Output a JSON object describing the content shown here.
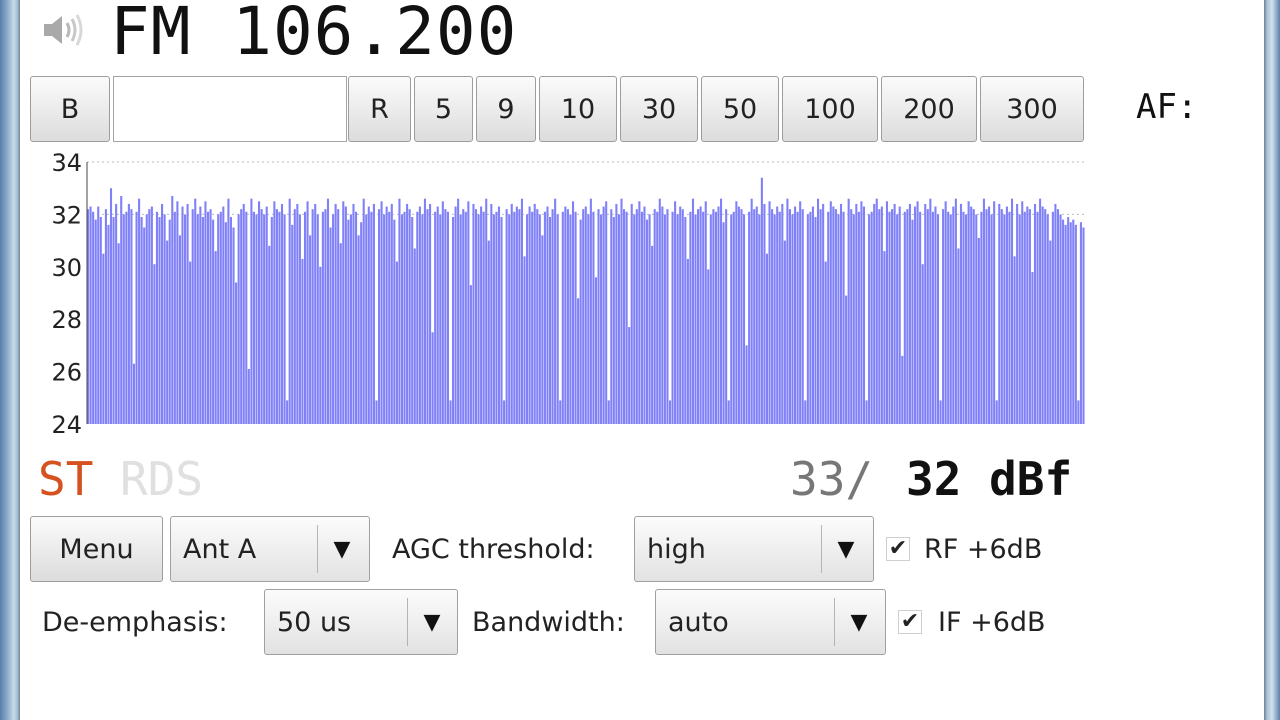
{
  "header": {
    "frequency": "FM 106.200",
    "af_label": "AF:",
    "speaker_icon": "speaker-icon"
  },
  "band_buttons": {
    "b": "B",
    "input_value": "",
    "r": "R",
    "steps": [
      "5",
      "9",
      "10",
      "30",
      "50",
      "100",
      "200",
      "300"
    ]
  },
  "indicators": {
    "stereo": "ST",
    "rds": "RDS",
    "stereo_color": "#d5511f",
    "rds_color": "#e0e0e0"
  },
  "signal": {
    "peak": "33/",
    "current": "32 dBf"
  },
  "controls": {
    "menu_label": "Menu",
    "antenna_value": "Ant A",
    "agc_label": "AGC threshold:",
    "agc_value": "high",
    "rf_label": "RF +6dB",
    "rf_checked": true,
    "deemphasis_label": "De-emphasis:",
    "deemphasis_value": "50 us",
    "bandwidth_label": "Bandwidth:",
    "bandwidth_value": "auto",
    "if_label": "IF +6dB",
    "if_checked": true,
    "check_mark": "✔",
    "dropdown_icon": "dropdown-arrow-icon"
  },
  "chart_data": {
    "type": "bar",
    "ylim": [
      24,
      34
    ],
    "yticks": [
      "34",
      "32",
      "30",
      "28",
      "26",
      "24"
    ],
    "bar_color": "#8080f8",
    "grid_color": "#bbbbbb",
    "series": [
      {
        "values": [
          32.2,
          32.3,
          32.1,
          31.8,
          32.3,
          31.9,
          32.0,
          32.2,
          31.6,
          33.0,
          31.9,
          32.4,
          32.1,
          32.7,
          32.0,
          32.1,
          32.4,
          32.2,
          30.0,
          32.1,
          32.6,
          31.9,
          31.5,
          32.0,
          32.2,
          32.3,
          32.5,
          32.1,
          31.9,
          32.4,
          32.0,
          32.2,
          31.8,
          32.7,
          32.1,
          32.5,
          31.2,
          32.3,
          32.0,
          32.4,
          32.1,
          32.2,
          32.6,
          32.0,
          32.3,
          31.9,
          32.5,
          32.1,
          32.2,
          31.8,
          32.4,
          32.0,
          32.1,
          32.3,
          31.7,
          32.6,
          31.9,
          31.5,
          32.3,
          32.0,
          32.2,
          32.4,
          32.1,
          26.1,
          32.6,
          32.1,
          32.0,
          32.5,
          32.2,
          32.0,
          32.3,
          32.1,
          31.9,
          32.5,
          32.2,
          32.1,
          32.4,
          32.0,
          32.3,
          32.6,
          31.6,
          32.2,
          32.4,
          32.0,
          32.3,
          32.1,
          32.5,
          31.2,
          32.2,
          32.4,
          32.0,
          32.3,
          32.1,
          32.2,
          32.6,
          31.5,
          32.0,
          32.4,
          32.2,
          32.1,
          32.5,
          32.3,
          31.8,
          32.0,
          32.4,
          32.1,
          32.2,
          31.7,
          32.6,
          32.0,
          32.3,
          32.1,
          32.4,
          31.9,
          32.2,
          32.5,
          32.0,
          32.3,
          32.1,
          32.4,
          31.8,
          32.2,
          32.6,
          32.0,
          32.1,
          32.4,
          32.2,
          31.9,
          32.5,
          32.1,
          32.3,
          32.0,
          32.6,
          32.2,
          32.4,
          31.5,
          32.1,
          32.3,
          32.0,
          32.5,
          32.2,
          32.1,
          32.4,
          31.9,
          32.3,
          32.6,
          32.0,
          32.2,
          32.1,
          32.5,
          31.8,
          32.4,
          32.2,
          32.0,
          32.3,
          32.1,
          32.6,
          32.2,
          32.4,
          32.0,
          32.1,
          32.3,
          31.9,
          32.5,
          32.2,
          32.0,
          32.4,
          32.1,
          32.3,
          32.2,
          32.6,
          31.7,
          32.0,
          32.3,
          32.1,
          32.4,
          32.2,
          32.0,
          32.5,
          32.1,
          32.3,
          31.9,
          32.2,
          32.6,
          32.0,
          32.4,
          32.1,
          32.3,
          32.2,
          32.0,
          32.5,
          32.1,
          32.4,
          31.8,
          32.2,
          32.3,
          32.0,
          32.6,
          32.1,
          32.4,
          32.2,
          32.0,
          32.3,
          32.5,
          32.1,
          32.2,
          31.9,
          32.4,
          32.0,
          32.6,
          32.2,
          32.1,
          32.3,
          32.4,
          32.0,
          32.2,
          32.5,
          32.1,
          32.3,
          31.8,
          32.0,
          32.4,
          32.2,
          32.1,
          32.6,
          32.3,
          32.0,
          32.2,
          32.4,
          32.1,
          32.5,
          32.0,
          32.3,
          32.2,
          31.9,
          32.4,
          32.1,
          32.6,
          32.0,
          32.2,
          32.3,
          32.1,
          32.5,
          32.4,
          32.0,
          32.2,
          32.1,
          32.3,
          32.6,
          31.7,
          32.2,
          32.4,
          32.0,
          32.1,
          32.5,
          32.3,
          32.2,
          32.0,
          32.4,
          32.1,
          32.6,
          32.2,
          32.3,
          32.0,
          33.4,
          32.4,
          32.1,
          32.5,
          32.2,
          32.0,
          32.3,
          32.1,
          32.4,
          31.8,
          32.6,
          32.2,
          32.0,
          32.3,
          32.1,
          32.5,
          32.2,
          32.4,
          32.0,
          32.1,
          32.3,
          31.9,
          32.6,
          32.2,
          32.4,
          32.0,
          32.1,
          32.5,
          32.3,
          32.2,
          32.0,
          32.4,
          32.1,
          32.3,
          32.6,
          32.2,
          32.0,
          32.4,
          32.1,
          32.5,
          32.3,
          32.2,
          32.0,
          32.1,
          32.4,
          32.6,
          32.2,
          32.3,
          32.0,
          32.5,
          32.1,
          32.2,
          32.4,
          32.0,
          32.3,
          32.6,
          32.1,
          32.2,
          32.4,
          31.8,
          32.3,
          32.5,
          32.1,
          32.0,
          32.4,
          32.2,
          32.6,
          32.1,
          32.3,
          32.0,
          32.4,
          32.2,
          32.5,
          32.1,
          32.0,
          32.3,
          32.6,
          32.2,
          32.4,
          32.1,
          32.0,
          32.5,
          32.3,
          32.2,
          32.0,
          32.4,
          32.1,
          32.6,
          32.2,
          32.3,
          32.0,
          32.5,
          32.1,
          32.4,
          32.2,
          32.0,
          32.3,
          32.1,
          32.6,
          32.2,
          32.4,
          32.0,
          32.5,
          32.1,
          32.3,
          32.2,
          32.0,
          32.4,
          32.1,
          32.6,
          32.3,
          32.2,
          32.0,
          32.5,
          32.1,
          32.4,
          32.2,
          32.0,
          31.8,
          31.6,
          31.9,
          31.7,
          31.8,
          31.6,
          24.9,
          31.7,
          31.5
        ]
      }
    ],
    "dips": [
      {
        "at": 6,
        "value": 30.5
      },
      {
        "at": 12,
        "value": 30.9
      },
      {
        "at": 18,
        "value": 26.3
      },
      {
        "at": 26,
        "value": 30.1
      },
      {
        "at": 31,
        "value": 31.0
      },
      {
        "at": 40,
        "value": 30.2
      },
      {
        "at": 50,
        "value": 30.6
      },
      {
        "at": 58,
        "value": 29.4
      },
      {
        "at": 63,
        "value": 26.1
      },
      {
        "at": 71,
        "value": 30.8
      },
      {
        "at": 78,
        "value": 24.9
      },
      {
        "at": 84,
        "value": 30.3
      },
      {
        "at": 91,
        "value": 30.0
      },
      {
        "at": 99,
        "value": 30.9
      },
      {
        "at": 106,
        "value": 31.2
      },
      {
        "at": 113,
        "value": 24.9
      },
      {
        "at": 121,
        "value": 30.2
      },
      {
        "at": 128,
        "value": 30.7
      },
      {
        "at": 135,
        "value": 27.5
      },
      {
        "at": 142,
        "value": 24.9
      },
      {
        "at": 150,
        "value": 29.3
      },
      {
        "at": 157,
        "value": 31.0
      },
      {
        "at": 163,
        "value": 24.9
      },
      {
        "at": 171,
        "value": 30.4
      },
      {
        "at": 178,
        "value": 31.2
      },
      {
        "at": 185,
        "value": 24.9
      },
      {
        "at": 192,
        "value": 28.8
      },
      {
        "at": 199,
        "value": 29.6
      },
      {
        "at": 204,
        "value": 24.9
      },
      {
        "at": 212,
        "value": 27.7
      },
      {
        "at": 221,
        "value": 30.8
      },
      {
        "at": 228,
        "value": 24.9
      },
      {
        "at": 235,
        "value": 30.3
      },
      {
        "at": 243,
        "value": 29.9
      },
      {
        "at": 251,
        "value": 24.9
      },
      {
        "at": 258,
        "value": 27.0
      },
      {
        "at": 266,
        "value": 30.5
      },
      {
        "at": 273,
        "value": 31.0
      },
      {
        "at": 281,
        "value": 24.9
      },
      {
        "at": 289,
        "value": 30.2
      },
      {
        "at": 297,
        "value": 28.9
      },
      {
        "at": 305,
        "value": 24.9
      },
      {
        "at": 312,
        "value": 30.6
      },
      {
        "at": 319,
        "value": 26.6
      },
      {
        "at": 327,
        "value": 30.1
      },
      {
        "at": 334,
        "value": 24.9
      },
      {
        "at": 341,
        "value": 30.7
      },
      {
        "at": 349,
        "value": 31.1
      },
      {
        "at": 356,
        "value": 24.9
      },
      {
        "at": 363,
        "value": 30.4
      },
      {
        "at": 370,
        "value": 29.8
      },
      {
        "at": 377,
        "value": 31.0
      }
    ]
  }
}
